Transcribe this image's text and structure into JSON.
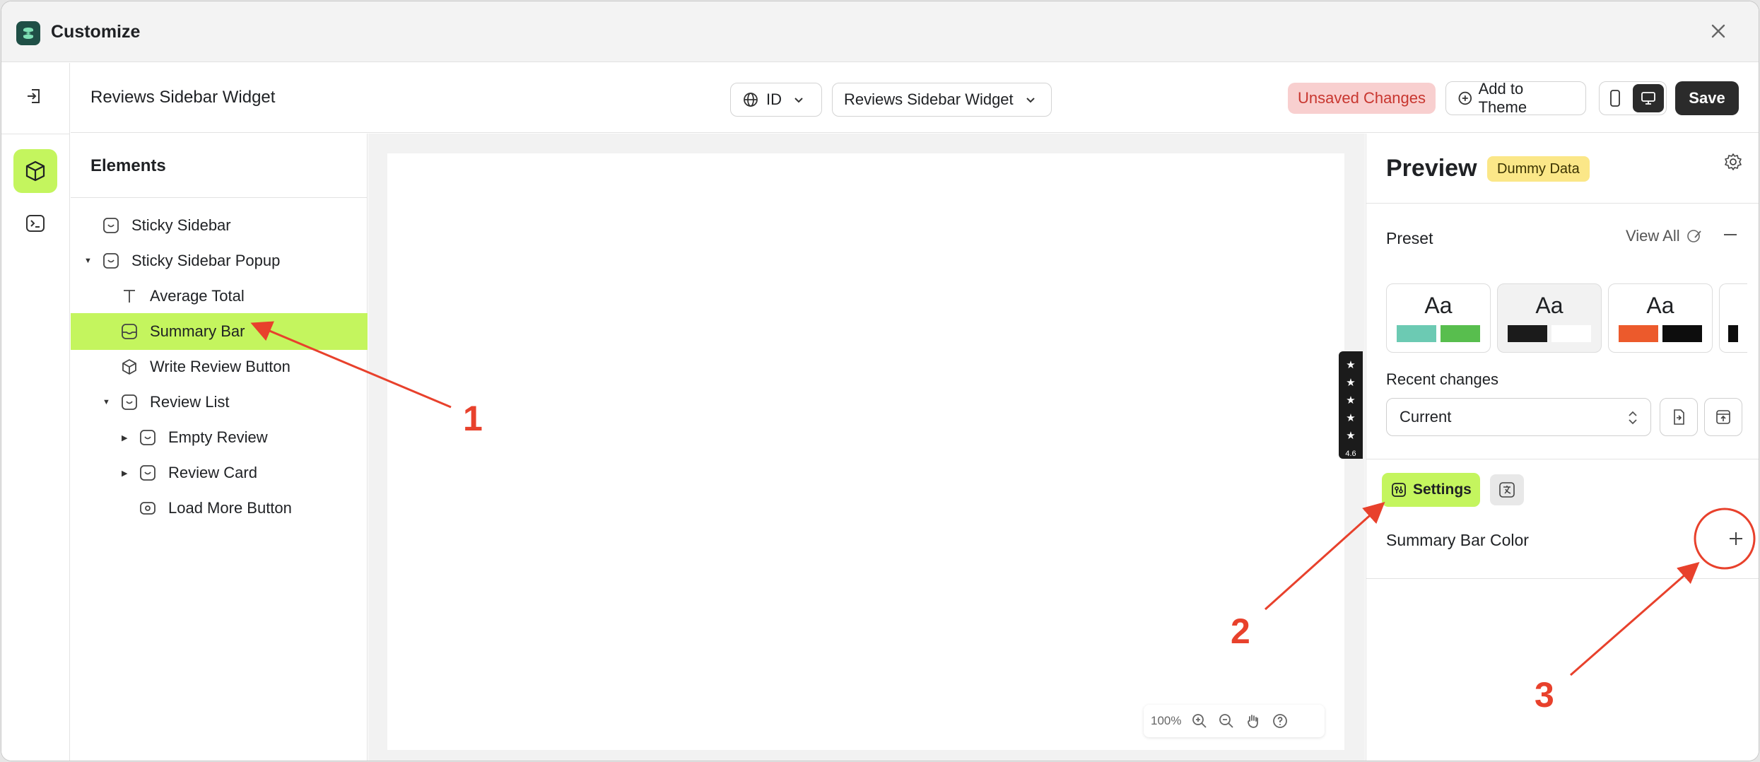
{
  "window": {
    "title": "Customize"
  },
  "toolbar": {
    "widget_title": "Reviews Sidebar Widget",
    "language_value": "ID",
    "widget_select_value": "Reviews Sidebar Widget",
    "unsaved_label": "Unsaved Changes",
    "add_to_theme_label": "Add to Theme",
    "save_label": "Save"
  },
  "elements_panel": {
    "heading": "Elements",
    "items": [
      {
        "label": "Sticky Sidebar"
      },
      {
        "label": "Sticky Sidebar Popup"
      },
      {
        "label": "Average Total"
      },
      {
        "label": "Summary Bar"
      },
      {
        "label": "Write Review Button"
      },
      {
        "label": "Review List"
      },
      {
        "label": "Empty Review"
      },
      {
        "label": "Review Card"
      },
      {
        "label": "Load More Button"
      }
    ]
  },
  "canvas": {
    "side_tab_rating": "4.6",
    "zoom_level": "100%"
  },
  "preview_panel": {
    "title": "Preview",
    "badge": "Dummy Data",
    "preset_label": "Preset",
    "view_all_label": "View All",
    "preset_text": "Aa",
    "presets": [
      {
        "colors": [
          "#6ccab3",
          "#58be4e"
        ]
      },
      {
        "colors": [
          "#1b1b1b",
          "#ffffff"
        ]
      },
      {
        "colors": [
          "#ec5a2c",
          "#0d0d0d"
        ]
      }
    ],
    "recent_changes_label": "Recent changes",
    "recent_changes_value": "Current",
    "settings_tab_label": "Settings",
    "summary_bar_color_label": "Summary Bar Color"
  },
  "annotations": [
    "1",
    "2",
    "3"
  ],
  "colors": {
    "accent": "#c4f55e",
    "annotation": "#e8412c",
    "unsaved_bg": "#f8cfcf",
    "dummy_badge_bg": "#fbe788"
  }
}
